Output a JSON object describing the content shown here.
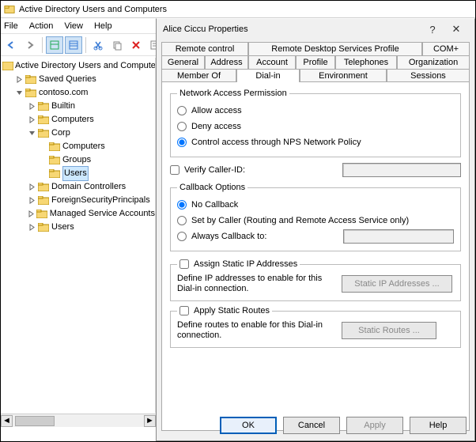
{
  "window": {
    "title": "Active Directory Users and Computers"
  },
  "menu": {
    "file": "File",
    "action": "Action",
    "view": "View",
    "help": "Help"
  },
  "toolbar_icons": {
    "back": "back-icon",
    "forward": "forward-icon",
    "up": "up-icon",
    "grid1": "grid-icon",
    "grid2": "detail-icon",
    "cut": "cut-icon",
    "copy": "copy-icon",
    "delete": "delete-icon",
    "props": "properties-icon",
    "help": "help-icon"
  },
  "tree": {
    "root": "Active Directory Users and Computers",
    "saved": "Saved Queries",
    "domain": "contoso.com",
    "builtin": "Builtin",
    "computers": "Computers",
    "corp": "Corp",
    "corp_computers": "Computers",
    "corp_groups": "Groups",
    "corp_users": "Users",
    "domain_controllers": "Domain Controllers",
    "fsp": "ForeignSecurityPrincipals",
    "msa": "Managed Service Accounts",
    "users": "Users"
  },
  "dialog": {
    "title": "Alice Ciccu Properties",
    "tabs_row1": {
      "remote_control": "Remote control",
      "rds_profile": "Remote Desktop Services Profile",
      "com": "COM+"
    },
    "tabs_row2": {
      "general": "General",
      "address": "Address",
      "account": "Account",
      "profile": "Profile",
      "telephones": "Telephones",
      "organization": "Organization"
    },
    "tabs_row3": {
      "member_of": "Member Of",
      "dial_in": "Dial-in",
      "environment": "Environment",
      "sessions": "Sessions"
    },
    "nap": {
      "legend": "Network Access Permission",
      "allow": "Allow access",
      "deny": "Deny access",
      "nps": "Control access through NPS Network Policy"
    },
    "verify_caller": "Verify Caller-ID:",
    "callback": {
      "legend": "Callback Options",
      "none": "No Callback",
      "caller": "Set by Caller (Routing and Remote Access Service only)",
      "always": "Always Callback to:"
    },
    "static_ip": {
      "check": "Assign Static IP Addresses",
      "desc": "Define IP addresses to enable for this Dial-in connection.",
      "button": "Static IP Addresses ..."
    },
    "static_routes": {
      "check": "Apply Static Routes",
      "desc": "Define routes to enable for this Dial-in connection.",
      "button": "Static Routes ..."
    },
    "buttons": {
      "ok": "OK",
      "cancel": "Cancel",
      "apply": "Apply",
      "help": "Help"
    }
  }
}
